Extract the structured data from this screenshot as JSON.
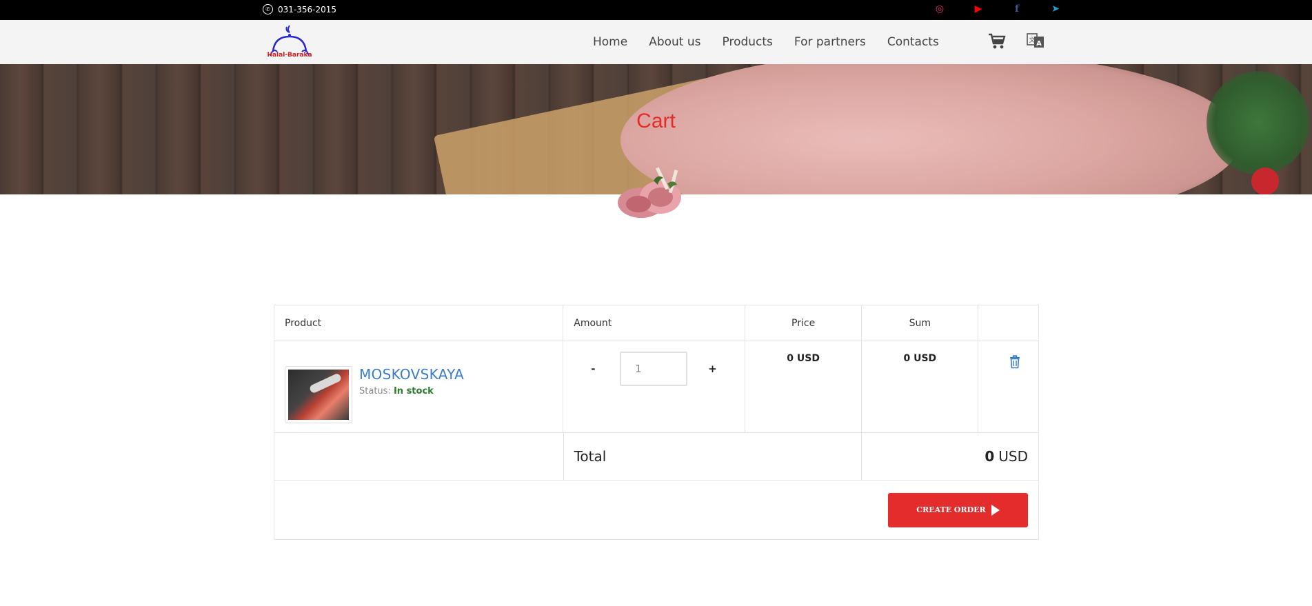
{
  "topbar": {
    "phone": "031-356-2015",
    "socials": [
      {
        "icon": "instagram-icon",
        "glyph": "◎"
      },
      {
        "icon": "youtube-icon",
        "glyph": "▶"
      },
      {
        "icon": "facebook-icon",
        "glyph": "f"
      },
      {
        "icon": "telegram-icon",
        "glyph": "➤"
      }
    ]
  },
  "header": {
    "logo_text": "Halal-Baraka",
    "nav": [
      "Home",
      "About us",
      "Products",
      "For partners",
      "Contacts"
    ]
  },
  "hero": {
    "title": "Cart"
  },
  "cart": {
    "headers": {
      "product": "Product",
      "amount": "Amount",
      "price": "Price",
      "sum": "Sum"
    },
    "items": [
      {
        "name": "MOSKOVSKAYA",
        "status_label": "Status:",
        "status_value": "In stock",
        "quantity": "1",
        "minus": "-",
        "plus": "+",
        "price": "0 USD",
        "sum": "0 USD"
      }
    ],
    "total_label": "Total",
    "total_value": "0",
    "total_currency": "USD",
    "create_order": "CREATE ORDER"
  },
  "colors": {
    "accent": "#e52c2c",
    "link": "#3b7cc4",
    "in_stock": "#2d7a2d"
  }
}
